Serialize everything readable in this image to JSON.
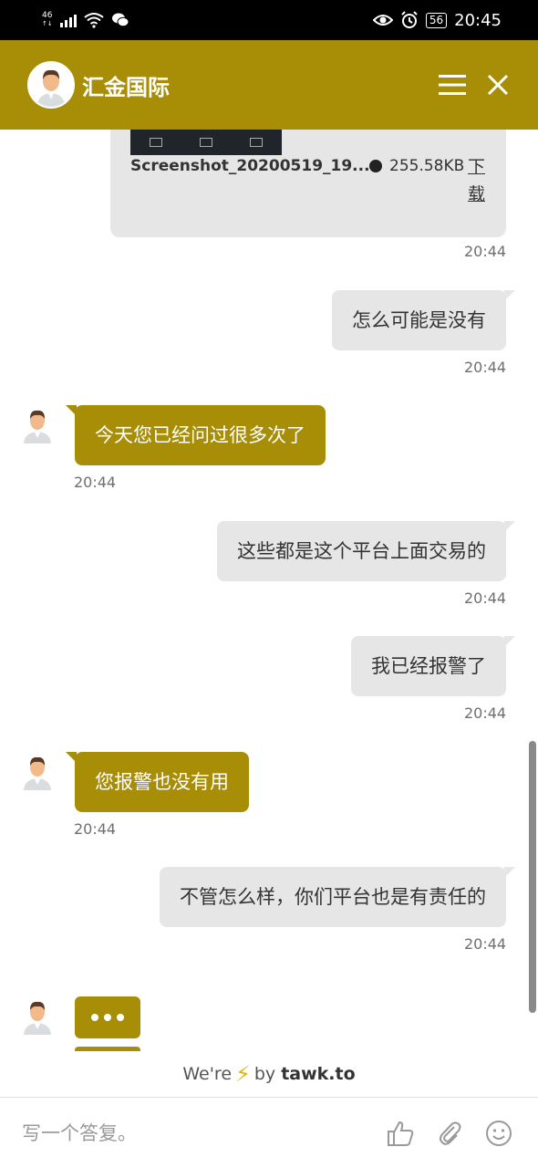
{
  "status_bar": {
    "network": "46",
    "battery": "56",
    "time": "20:45"
  },
  "header": {
    "title": "汇金国际"
  },
  "attachment": {
    "file_name": "Screenshot_20200519_19...",
    "file_size": "255.58KB",
    "download_label": "下载",
    "time": "20:44"
  },
  "messages": [
    {
      "text": "怎么可能是没有",
      "time": "20:44"
    },
    {
      "text": "今天您已经问过很多次了",
      "time": "20:44"
    },
    {
      "text": "这些都是这个平台上面交易的",
      "time": "20:44"
    },
    {
      "text": "我已经报警了",
      "time": "20:44"
    },
    {
      "text": "您报警也没有用",
      "time": "20:44"
    },
    {
      "text": "不管怎么样，你们平台也是有责任的",
      "time": "20:44"
    }
  ],
  "footer": {
    "powered_prefix": "We're",
    "powered_by": "by",
    "brand": "tawk.to"
  },
  "composer": {
    "placeholder": "写一个答复。"
  },
  "colors": {
    "brand": "#a88d07",
    "outgoing_bubble": "#e6e6e6"
  }
}
